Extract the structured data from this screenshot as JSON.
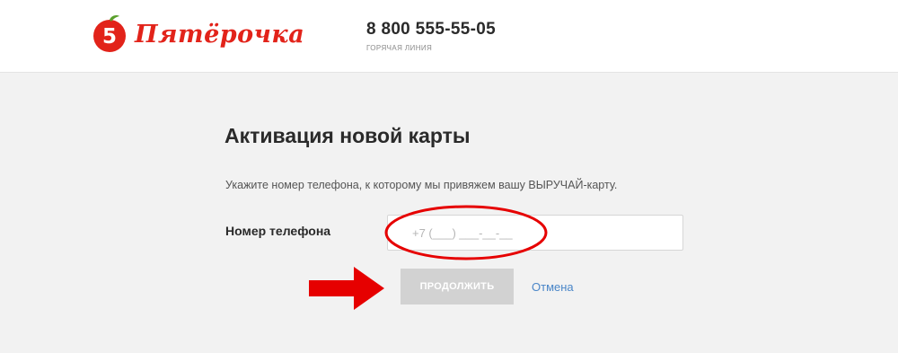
{
  "header": {
    "brand_name": "Пятёрочка",
    "logo_icon": "pyaterochka-logo-icon",
    "hotline_number": "8 800 555-55-05",
    "hotline_label": "ГОРЯЧАЯ ЛИНИЯ"
  },
  "form": {
    "title": "Активация новой карты",
    "description": "Укажите номер телефона, к которому мы привяжем вашу ВЫРУЧАЙ-карту.",
    "phone_label": "Номер телефона",
    "phone_placeholder": "+7 (___) ___-__-__",
    "phone_value": "",
    "continue_label": "ПРОДОЛЖИТЬ",
    "cancel_label": "Отмена"
  },
  "annotations": {
    "highlight_icon": "red-ellipse-highlight",
    "arrow_icon": "red-arrow-right-icon"
  },
  "colors": {
    "brand_red": "#e2231a",
    "page_background": "#f2f2f2",
    "button_disabled": "#d2d2d2",
    "link_blue": "#4a86c8",
    "annotation_red": "#e60000"
  }
}
